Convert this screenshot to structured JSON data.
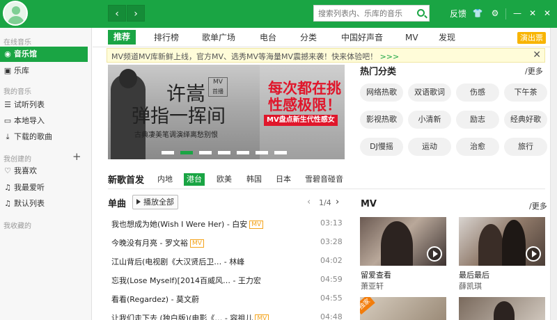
{
  "topbar": {
    "back_icon": "chevron-left-icon",
    "forward_icon": "chevron-right-icon",
    "search_placeholder": "搜索列表内、乐库的音乐",
    "feedback": "反馈",
    "skin_icon": "shirt-icon",
    "settings_icon": "gear-icon",
    "minimize": "—",
    "mini": "✕",
    "close": "✕",
    "back_glyph": "‹",
    "forward_glyph": "›",
    "shirt_glyph": "👕",
    "gear_glyph": "⚙"
  },
  "sidebar": {
    "sections": {
      "online": "在线音乐",
      "mine": "我的音乐",
      "created": "我创建的",
      "collected": "我收藏的"
    },
    "items": [
      {
        "label": "音乐馆",
        "icon": "◉"
      },
      {
        "label": "乐库",
        "icon": "▣"
      },
      {
        "label": "试听列表",
        "icon": "☰"
      },
      {
        "label": "本地导入",
        "icon": "▭"
      },
      {
        "label": "下载的歌曲",
        "icon": "⤓"
      },
      {
        "label": "我喜欢",
        "icon": "♡"
      },
      {
        "label": "我最爱听",
        "icon": "♫"
      },
      {
        "label": "默认列表",
        "icon": "♫"
      }
    ],
    "plus": "+"
  },
  "tabs": {
    "items": [
      "推荐",
      "排行榜",
      "歌单广场",
      "电台",
      "分类",
      "中国好声音",
      "MV",
      "发现"
    ],
    "ticket": "演出票"
  },
  "notice": {
    "text": "MV频道MV库新鲜上线，官方MV、选秀MV等海量MV震撼来袭！快来体验吧！",
    "more": ">>>",
    "close": "✕"
  },
  "banner": {
    "line1": "许嵩",
    "line2": "弹指一挥间",
    "line3": "古典凄美笔调演绎离愁别恨",
    "badge_top": "MV",
    "badge_bottom": "首播",
    "right1": "每次都在挑",
    "right2": "性感极限！",
    "right3": "MV盘点新生代性感女",
    "slides_total": 7,
    "active_slide": 2
  },
  "hot": {
    "title": "热门分类",
    "more": "/更多",
    "pills": [
      "网络热歌",
      "双语歌词",
      "伤感",
      "下午茶",
      "影视热歌",
      "小清新",
      "励志",
      "经典好歌",
      "DJ慢摇",
      "运动",
      "治愈",
      "旅行"
    ]
  },
  "newsongs": {
    "title": "新歌首发",
    "tabs": [
      "内地",
      "港台",
      "欧美",
      "韩国",
      "日本",
      "雪碧音碰音"
    ],
    "active_tab": "港台"
  },
  "singles": {
    "title": "单曲",
    "play_all": "播放全部",
    "prev": "‹",
    "page": "1/4",
    "next": "›",
    "mv_tag": "MV",
    "songs": [
      {
        "name": "我也想成为她(Wish I Were Her) - 白安",
        "mv": true,
        "time": "03:13"
      },
      {
        "name": "今晚没有月亮 - 罗文裕",
        "mv": true,
        "time": "03:28"
      },
      {
        "name": "江山背后(电视剧《大汉贤后卫… - 林峰",
        "mv": false,
        "time": "04:02"
      },
      {
        "name": "忘我(Lose Myself)[2014百威风… - 王力宏",
        "mv": false,
        "time": "04:59"
      },
      {
        "name": "看看(Regardez) - 莫文蔚",
        "mv": false,
        "time": "04:55"
      },
      {
        "name": "让我们走下去 (独白版)(电影《… - 容祖儿",
        "mv": true,
        "time": "04:48"
      }
    ]
  },
  "mv": {
    "title": "MV",
    "more": "/更多",
    "hot_tag": "独家",
    "items": [
      {
        "name": "留爱查看",
        "artist": "萧亚轩"
      },
      {
        "name": "最后最后",
        "artist": "薛凯琪"
      }
    ]
  },
  "colors": {
    "brand": "#1aa544",
    "ticket": "#f8b400",
    "notice_bg": "#fffcd9",
    "banner_red": "#e0162b"
  }
}
